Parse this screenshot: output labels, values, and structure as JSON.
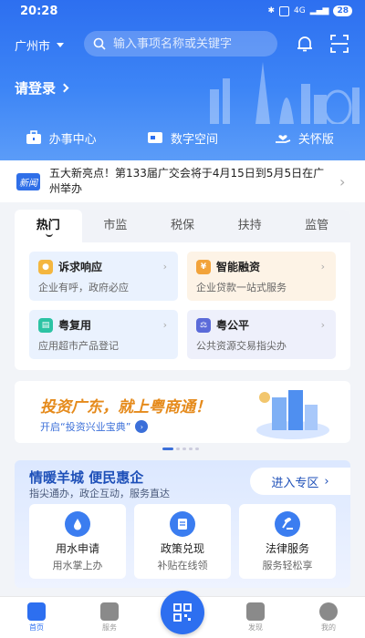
{
  "status_bar": {
    "time": "20:28",
    "battery": "28",
    "network": "4G"
  },
  "header": {
    "city": "广州市",
    "search_placeholder": "输入事项名称或关键字",
    "login": "请登录"
  },
  "quick_bar": [
    {
      "label": "办事中心",
      "icon": "briefcase-icon"
    },
    {
      "label": "数字空间",
      "icon": "id-card-icon"
    },
    {
      "label": "关怀版",
      "icon": "care-hand-icon"
    }
  ],
  "news": {
    "tag": "新闻",
    "text": "五大新亮点！第133届广交会将于4月15日到5月5日在广州举办"
  },
  "tabs": [
    {
      "label": "热门",
      "active": true
    },
    {
      "label": "市监",
      "active": false
    },
    {
      "label": "税保",
      "active": false
    },
    {
      "label": "扶持",
      "active": false
    },
    {
      "label": "监管",
      "active": false
    }
  ],
  "services": [
    {
      "title": "诉求响应",
      "desc": "企业有呼，政府必应",
      "icon": "speech-icon",
      "bg": "#eaf2fe",
      "ic": "#f4b63f"
    },
    {
      "title": "智能融资",
      "desc": "企业贷款一站式服务",
      "icon": "yuan-icon",
      "bg": "#fdf3e6",
      "ic": "#f2a33a"
    },
    {
      "title": "粤复用",
      "desc": "应用超市产品登记",
      "icon": "cart-icon",
      "bg": "#eaf2fe",
      "ic": "#2cc3a4"
    },
    {
      "title": "粤公平",
      "desc": "公共资源交易指尖办",
      "icon": "scale-icon",
      "bg": "#eef0fb",
      "ic": "#5b6bd9"
    }
  ],
  "banner": {
    "title": "投资广东，就上粤商通！",
    "subtitle": "开启“投资兴业宝典”"
  },
  "warm": {
    "title": "情暖羊城 便民惠企",
    "subtitle": "指尖通办，政企互动，服务直达",
    "enter": "进入专区",
    "cards": [
      {
        "l1": "用水申请",
        "l2": "用水掌上办",
        "icon": "water-drop-icon"
      },
      {
        "l1": "政策兑现",
        "l2": "补贴在线领",
        "icon": "document-icon"
      },
      {
        "l1": "法律服务",
        "l2": "服务轻松享",
        "icon": "gavel-icon"
      }
    ]
  },
  "nav": [
    {
      "label": "首页",
      "icon": "home-icon",
      "active": true
    },
    {
      "label": "服务",
      "icon": "service-icon",
      "active": false
    },
    {
      "label": "",
      "icon": "scan-qr-icon",
      "active": false
    },
    {
      "label": "发现",
      "icon": "discover-icon",
      "active": false
    },
    {
      "label": "我的",
      "icon": "profile-icon",
      "active": false
    }
  ],
  "colors": {
    "primary": "#2d6ff0",
    "accent_orange": "#e58a1b"
  }
}
